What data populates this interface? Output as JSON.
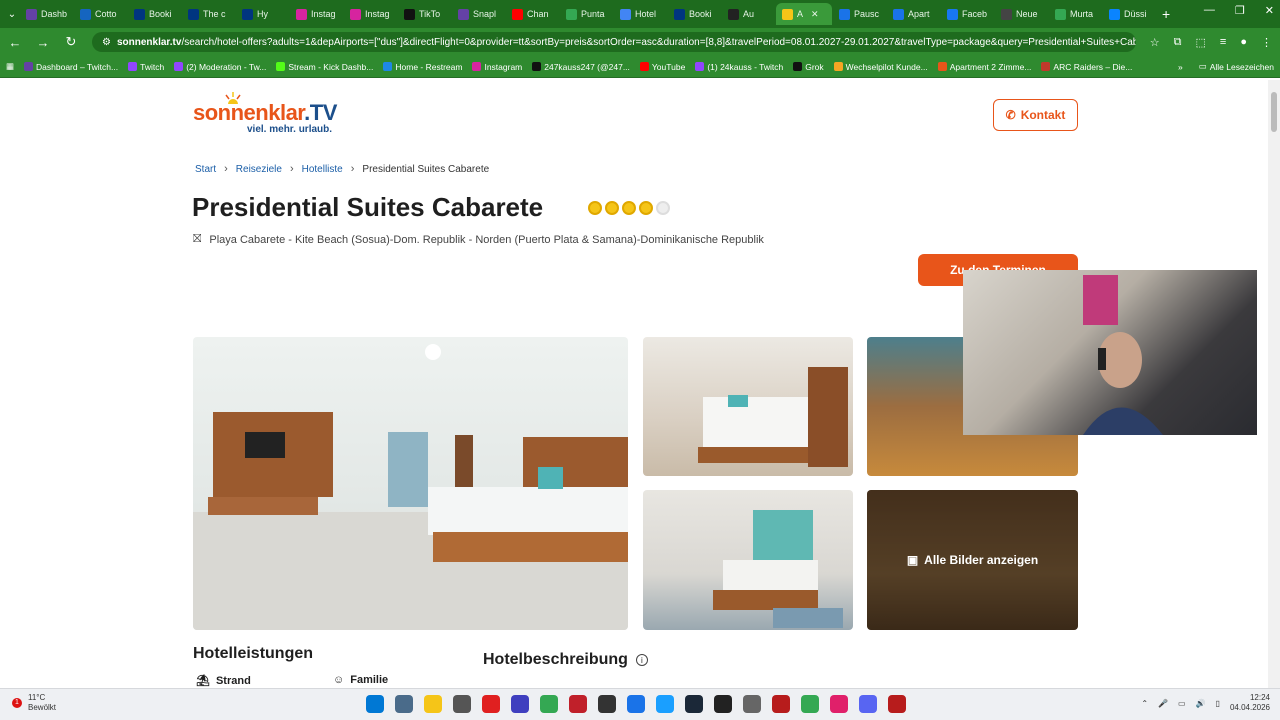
{
  "browser": {
    "tabs": [
      {
        "label": "Dashb",
        "color": "#6441a5"
      },
      {
        "label": "Cotto",
        "color": "#1565c0"
      },
      {
        "label": "Booki",
        "color": "#003580"
      },
      {
        "label": "The c",
        "color": "#003580"
      },
      {
        "label": "Hy",
        "color": "#003580"
      },
      {
        "label": "Instag",
        "color": "#d6249f"
      },
      {
        "label": "Instag",
        "color": "#d6249f"
      },
      {
        "label": "TikTo",
        "color": "#111111"
      },
      {
        "label": "Snapl",
        "color": "#6441a5"
      },
      {
        "label": "Chan",
        "color": "#ff0000"
      },
      {
        "label": "Punta",
        "color": "#34a853"
      },
      {
        "label": "Hotel",
        "color": "#4285f4"
      },
      {
        "label": "Booki",
        "color": "#003580"
      },
      {
        "label": "Au",
        "color": "#222222"
      },
      {
        "label": "A",
        "color": "#f5c518",
        "active": true
      },
      {
        "label": "Pausc",
        "color": "#1a73e8"
      },
      {
        "label": "Apart",
        "color": "#1a73e8"
      },
      {
        "label": "Faceb",
        "color": "#1877f2"
      },
      {
        "label": "Neue",
        "color": "#444444"
      },
      {
        "label": "Murta",
        "color": "#34a853"
      },
      {
        "label": "Düssi",
        "color": "#0a84ff"
      }
    ],
    "new_tab": "+",
    "url_host": "sonnenklar.tv",
    "url_path": "/search/hotel-offers?adults=1&depAirports=[\"dus\"]&directFlight=0&provider=tt&sortBy=preis&sortOrder=asc&duration=[8,8]&travelPeriod=08.01.2027-29.01.2027&travelType=package&query=Presidential+Suites+Cabarete&d...",
    "bookmarks": [
      {
        "label": "Dashboard – Twitch...",
        "color": "#6441a5"
      },
      {
        "label": "Twitch",
        "color": "#9146ff"
      },
      {
        "label": "(2) Moderation - Tw...",
        "color": "#9146ff"
      },
      {
        "label": "Stream - Kick Dashb...",
        "color": "#53fc18"
      },
      {
        "label": "Home - Restream",
        "color": "#1e88e5"
      },
      {
        "label": "Instagram",
        "color": "#d6249f"
      },
      {
        "label": "247kauss247 (@247...",
        "color": "#111111"
      },
      {
        "label": "YouTube",
        "color": "#ff0000"
      },
      {
        "label": "(1) 24kauss - Twitch",
        "color": "#9146ff"
      },
      {
        "label": "Grok",
        "color": "#111111"
      },
      {
        "label": "Wechselpilot Kunde...",
        "color": "#f5a623"
      },
      {
        "label": "Apartment 2 Zimme...",
        "color": "#e8551a"
      },
      {
        "label": "ARC Raiders – Die...",
        "color": "#c0392b"
      }
    ],
    "bookmarks_more": "»",
    "all_bookmarks": "Alle Lesezeichen"
  },
  "site": {
    "logo_brand_a": "sonnenklar",
    "logo_brand_b": ".TV",
    "logo_tagline": "viel. mehr. urlaub.",
    "contact_label": "Kontakt",
    "breadcrumb": [
      "Start",
      "Reiseziele",
      "Hotelliste",
      "Presidential Suites Cabarete"
    ],
    "hotel_name": "Presidential Suites Cabarete",
    "stars": 4,
    "stars_max": 5,
    "location": "Playa Cabarete - Kite Beach (Sosua)-Dom. Republik - Norden (Puerto Plata & Samana)-Dominikanische Republik",
    "dates_button": "Zu den Terminen",
    "all_images_label": "Alle Bilder anzeigen",
    "services_heading": "Hotelleistungen",
    "features": [
      "Strand",
      "Familie"
    ],
    "description_heading": "Hotelbeschreibung"
  },
  "taskbar": {
    "temp": "11°C",
    "weather": "Bewölkt",
    "notification_count": "1",
    "time": "12:24",
    "date": "04.04.2026",
    "apps": [
      {
        "name": "windows-start-icon",
        "color": "#0078d4"
      },
      {
        "name": "calculator-icon",
        "color": "#4a6b8a"
      },
      {
        "name": "file-explorer-icon",
        "color": "#f5c518"
      },
      {
        "name": "mouse-icon",
        "color": "#555555"
      },
      {
        "name": "opera-gx-icon",
        "color": "#e02020"
      },
      {
        "name": "vpn-icon",
        "color": "#3f3fbf"
      },
      {
        "name": "layers-icon",
        "color": "#34a853"
      },
      {
        "name": "recorder-icon",
        "color": "#c0202a"
      },
      {
        "name": "obs-icon",
        "color": "#333333"
      },
      {
        "name": "launcher-icon",
        "color": "#1a73e8"
      },
      {
        "name": "battlenet-icon",
        "color": "#1a9fff"
      },
      {
        "name": "steam-icon",
        "color": "#1b2838"
      },
      {
        "name": "epic-icon",
        "color": "#222222"
      },
      {
        "name": "settings-gear-icon",
        "color": "#666666"
      },
      {
        "name": "stream-app-icon",
        "color": "#b71c1c"
      },
      {
        "name": "chrome-icon",
        "color": "#34a853"
      },
      {
        "name": "opera-icon",
        "color": "#e0206a"
      },
      {
        "name": "discord-icon",
        "color": "#5865f2"
      },
      {
        "name": "stream-app-2-icon",
        "color": "#b71c1c"
      }
    ]
  },
  "colors": {
    "accent": "#e8551a",
    "link": "#1c5fa8",
    "browser": "#2f8a2f"
  }
}
